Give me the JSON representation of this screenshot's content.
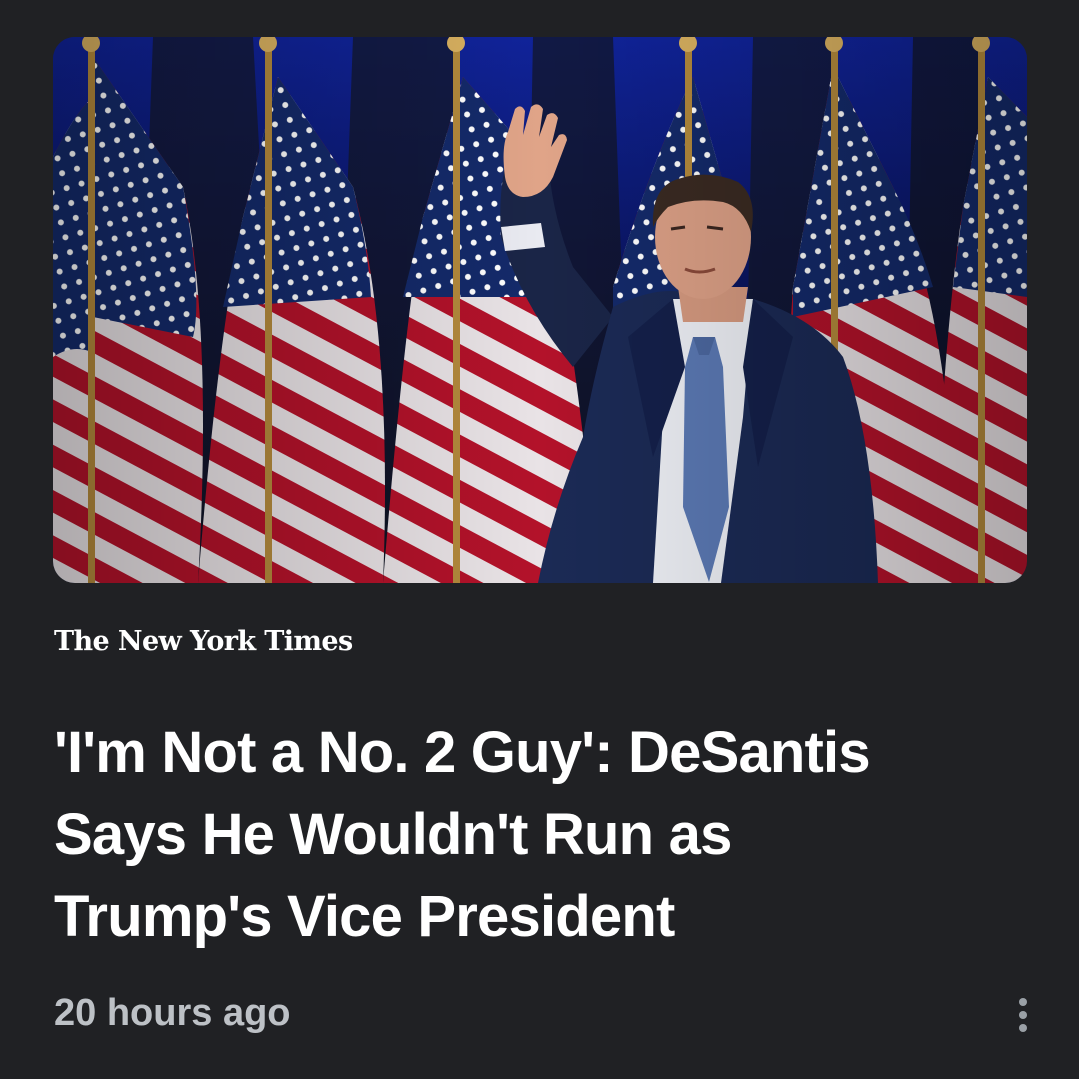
{
  "article": {
    "image_alt": "Ron DeSantis waving in front of American flags",
    "source": "The New York Times",
    "headline_lines": [
      "'I'm Not a No. 2 Guy': DeSantis",
      "Says He Wouldn't Run as",
      "Trump's Vice President"
    ],
    "timestamp": "20 hours ago",
    "more_options_icon": "more-vert-icon"
  },
  "colors": {
    "background": "#202124",
    "headline": "#ffffff",
    "timestamp": "#bdc1c6",
    "icon": "#9aa0a6"
  }
}
